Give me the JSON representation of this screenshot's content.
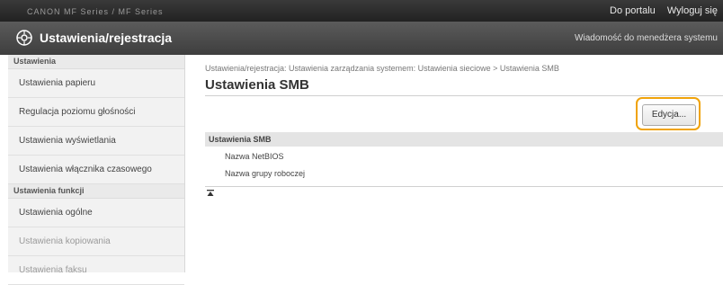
{
  "topbar": {
    "left_text": "CANON   MF Series / MF Series",
    "portal_link": "Do portalu",
    "logout_link": "Wyloguj się"
  },
  "titlebar": {
    "title": "Ustawienia/rejestracja",
    "message": "Wiadomość do menedżera systemu"
  },
  "sidebar": {
    "groups": [
      {
        "heading": "Ustawienia",
        "items": [
          {
            "label": "Ustawienia papieru"
          },
          {
            "label": "Regulacja poziomu głośności"
          },
          {
            "label": "Ustawienia wyświetlania"
          },
          {
            "label": "Ustawienia włącznika czasowego"
          }
        ]
      },
      {
        "heading": "Ustawienia funkcji",
        "items": [
          {
            "label": "Ustawienia ogólne"
          },
          {
            "label": "Ustawienia kopiowania"
          },
          {
            "label": "Ustawienia faksu"
          }
        ]
      }
    ]
  },
  "main": {
    "breadcrumb": "Ustawienia/rejestracja: Ustawienia zarządzania systemem: Ustawienia sieciowe > Ustawienia SMB",
    "page_title": "Ustawienia SMB",
    "edit_button": "Edycja...",
    "section_heading": "Ustawienia SMB",
    "rows": [
      {
        "label": "Nazwa NetBIOS"
      },
      {
        "label": "Nazwa grupy roboczej"
      }
    ]
  },
  "colors": {
    "highlight": "#f0a30a",
    "titlebar": "#4a4a4a"
  }
}
